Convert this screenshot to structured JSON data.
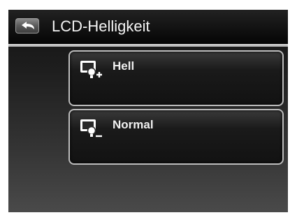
{
  "header": {
    "title": "LCD-Helligkeit"
  },
  "options": [
    {
      "label": "Hell",
      "icon": "brightness-plus-icon"
    },
    {
      "label": "Normal",
      "icon": "brightness-minus-icon"
    }
  ],
  "colors": {
    "background": "#1a1a1a",
    "text": "#f0f0f0",
    "border": "#bdbdbd"
  }
}
